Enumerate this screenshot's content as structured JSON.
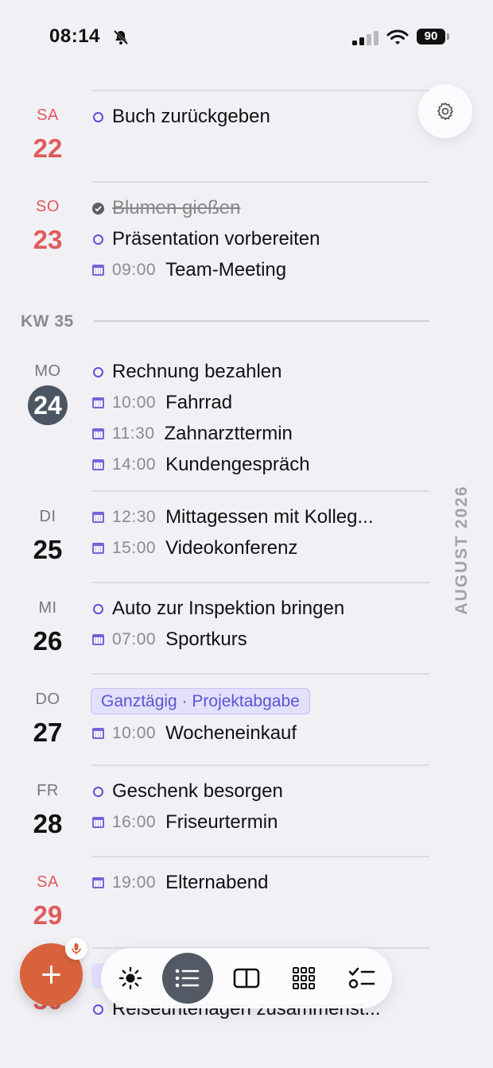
{
  "status_bar": {
    "time": "08:14",
    "battery": "90"
  },
  "month_label": "AUGUST 2026",
  "week_label": "KW 35",
  "days": [
    {
      "name": "SA",
      "num": "22",
      "items": [
        {
          "type": "task",
          "title": "Buch zurückgeben"
        }
      ]
    },
    {
      "name": "SO",
      "num": "23",
      "items": [
        {
          "type": "task-done",
          "title": "Blumen gießen"
        },
        {
          "type": "task",
          "title": "Präsentation vorbereiten"
        },
        {
          "type": "event",
          "time": "09:00",
          "title": "Team-Meeting"
        }
      ]
    },
    {
      "name": "MO",
      "num": "24",
      "today": true,
      "items": [
        {
          "type": "task",
          "title": "Rechnung bezahlen"
        },
        {
          "type": "event",
          "time": "10:00",
          "title": "Fahrrad"
        },
        {
          "type": "event",
          "time": "11:30",
          "title": "Zahnarzttermin"
        },
        {
          "type": "event",
          "time": "14:00",
          "title": "Kundengespräch"
        }
      ]
    },
    {
      "name": "DI",
      "num": "25",
      "items": [
        {
          "type": "event",
          "time": "12:30",
          "title": "Mittagessen mit Kolleg..."
        },
        {
          "type": "event",
          "time": "15:00",
          "title": "Videokonferenz"
        }
      ]
    },
    {
      "name": "MI",
      "num": "26",
      "items": [
        {
          "type": "task",
          "title": "Auto zur Inspektion bringen"
        },
        {
          "type": "event",
          "time": "07:00",
          "title": "Sportkurs"
        }
      ]
    },
    {
      "name": "DO",
      "num": "27",
      "allday": "Ganztägig · Projektabgabe",
      "items": [
        {
          "type": "event",
          "time": "10:00",
          "title": "Wocheneinkauf"
        }
      ]
    },
    {
      "name": "FR",
      "num": "28",
      "items": [
        {
          "type": "task",
          "title": "Geschenk besorgen"
        },
        {
          "type": "event",
          "time": "16:00",
          "title": "Friseurtermin"
        }
      ]
    },
    {
      "name": "SA",
      "num": "29",
      "items": [
        {
          "type": "event",
          "time": "19:00",
          "title": "Elternabend"
        }
      ]
    },
    {
      "num": "30",
      "items": [
        {
          "type": "task",
          "title": "Reiseunterlagen zusammenst..."
        }
      ]
    }
  ],
  "icons": {
    "settings": "gear-icon",
    "add": "plus-icon",
    "mic": "microphone-icon",
    "nav": [
      "sun-icon",
      "list-icon",
      "split-view-icon",
      "grid-icon",
      "checklist-icon"
    ]
  },
  "colors": {
    "accent": "#5a54d6",
    "weekend": "#e05b5b",
    "fab": "#d7623b",
    "today": "#4b5563"
  }
}
